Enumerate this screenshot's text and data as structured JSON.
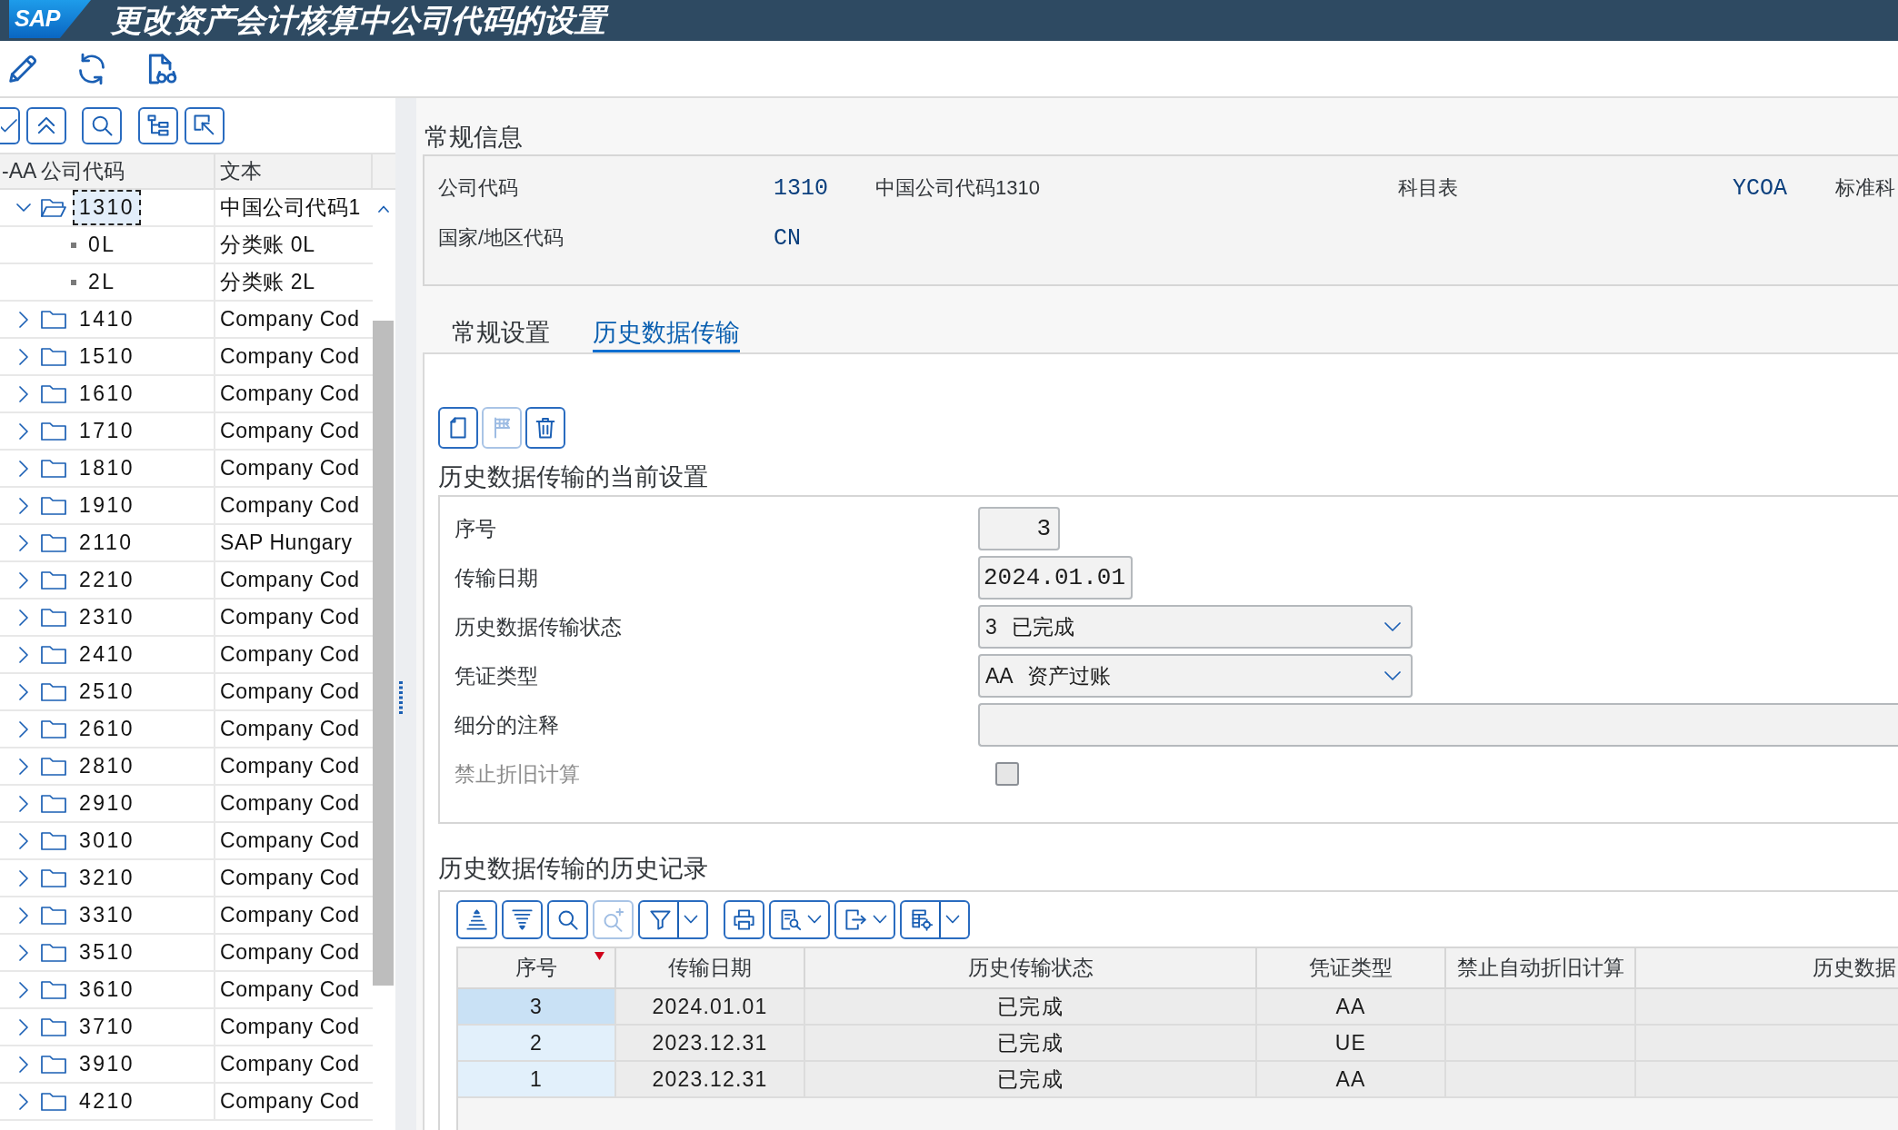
{
  "window": {
    "logo": "SAP",
    "title": "更改资产会计核算中公司代码的设置"
  },
  "toolbar": [
    {
      "kind": "edit"
    },
    {
      "kind": "refresh"
    },
    {
      "kind": "display"
    }
  ],
  "tree_toolbar": [
    {
      "kind": "check"
    },
    {
      "kind": "collapse"
    },
    {
      "kind": "search"
    },
    {
      "kind": "tree"
    },
    {
      "kind": "select"
    }
  ],
  "tree": {
    "columns": [
      "-AA 公司代码",
      "文本"
    ],
    "items": [
      {
        "kind": "folder",
        "code": "1310",
        "text": "中国公司代码1",
        "expanded": true,
        "selected": true,
        "children": [
          {
            "kind": "leaf",
            "code": "0L",
            "text": "分类账 0L",
            "selected": false
          },
          {
            "kind": "leaf",
            "code": "2L",
            "text": "分类账 2L",
            "selected": false
          }
        ]
      },
      {
        "kind": "folder",
        "code": "1410",
        "text": "Company Cod",
        "expanded": false,
        "selected": false
      },
      {
        "kind": "folder",
        "code": "1510",
        "text": "Company Cod",
        "expanded": false,
        "selected": false
      },
      {
        "kind": "folder",
        "code": "1610",
        "text": "Company Cod",
        "expanded": false,
        "selected": false
      },
      {
        "kind": "folder",
        "code": "1710",
        "text": "Company Cod",
        "expanded": false,
        "selected": false
      },
      {
        "kind": "folder",
        "code": "1810",
        "text": "Company Cod",
        "expanded": false,
        "selected": false
      },
      {
        "kind": "folder",
        "code": "1910",
        "text": "Company Cod",
        "expanded": false,
        "selected": false
      },
      {
        "kind": "folder",
        "code": "2110",
        "text": "SAP Hungary",
        "expanded": false,
        "selected": false
      },
      {
        "kind": "folder",
        "code": "2210",
        "text": "Company Cod",
        "expanded": false,
        "selected": false
      },
      {
        "kind": "folder",
        "code": "2310",
        "text": "Company Cod",
        "expanded": false,
        "selected": false
      },
      {
        "kind": "folder",
        "code": "2410",
        "text": "Company Cod",
        "expanded": false,
        "selected": false
      },
      {
        "kind": "folder",
        "code": "2510",
        "text": "Company Cod",
        "expanded": false,
        "selected": false
      },
      {
        "kind": "folder",
        "code": "2610",
        "text": "Company Cod",
        "expanded": false,
        "selected": false
      },
      {
        "kind": "folder",
        "code": "2810",
        "text": "Company Cod",
        "expanded": false,
        "selected": false
      },
      {
        "kind": "folder",
        "code": "2910",
        "text": "Company Cod",
        "expanded": false,
        "selected": false
      },
      {
        "kind": "folder",
        "code": "3010",
        "text": "Company Cod",
        "expanded": false,
        "selected": false
      },
      {
        "kind": "folder",
        "code": "3210",
        "text": "Company Cod",
        "expanded": false,
        "selected": false
      },
      {
        "kind": "folder",
        "code": "3310",
        "text": "Company Cod",
        "expanded": false,
        "selected": false
      },
      {
        "kind": "folder",
        "code": "3510",
        "text": "Company Cod",
        "expanded": false,
        "selected": false
      },
      {
        "kind": "folder",
        "code": "3610",
        "text": "Company Cod",
        "expanded": false,
        "selected": false
      },
      {
        "kind": "folder",
        "code": "3710",
        "text": "Company Cod",
        "expanded": false,
        "selected": false
      },
      {
        "kind": "folder",
        "code": "3910",
        "text": "Company Cod",
        "expanded": false,
        "selected": false
      },
      {
        "kind": "folder",
        "code": "4210",
        "text": "Company Cod",
        "expanded": false,
        "selected": false
      }
    ]
  },
  "general_info": {
    "title": "常规信息",
    "fields": [
      {
        "label": "公司代码",
        "value": "1310",
        "description": "中国公司代码1310"
      },
      {
        "label": "科目表",
        "value": "YCOA",
        "description": "标准科"
      },
      {
        "label": "国家/地区代码",
        "value": "CN"
      }
    ]
  },
  "tabs": [
    {
      "label": "常规设置",
      "selected": false
    },
    {
      "label": "历史数据传输",
      "selected": true
    }
  ],
  "current_settings": {
    "toolbar": [
      {
        "kind": "new",
        "disabled": false
      },
      {
        "kind": "flag",
        "disabled": true
      },
      {
        "kind": "delete",
        "disabled": false
      }
    ],
    "title": "历史数据传输的当前设置",
    "fields": [
      {
        "kind": "number",
        "label": "序号",
        "value": "3"
      },
      {
        "kind": "date",
        "label": "传输日期",
        "value": "2024.01.01"
      },
      {
        "kind": "select",
        "label": "历史数据传输状态",
        "value": "3 已完成"
      },
      {
        "kind": "select",
        "label": "凭证类型",
        "value": "AA 资产过账"
      },
      {
        "kind": "text",
        "label": "细分的注释"
      },
      {
        "kind": "checkbox",
        "label": "禁止折旧计算",
        "checked": false,
        "disabled": true
      }
    ]
  },
  "history": {
    "title": "历史数据传输的历史记录",
    "toolbar": [
      {
        "kind": "sort-asc",
        "disabled": false,
        "dropdown": false,
        "split": false
      },
      {
        "kind": "sort-desc",
        "disabled": false,
        "dropdown": false,
        "split": false
      },
      {
        "kind": "find",
        "disabled": false,
        "dropdown": false,
        "split": false
      },
      {
        "kind": "find-next",
        "disabled": true,
        "dropdown": false,
        "split": false
      },
      {
        "kind": "filter",
        "disabled": false,
        "dropdown": true,
        "split": true
      },
      {
        "kind": "print",
        "disabled": false,
        "dropdown": false,
        "split": false
      },
      {
        "kind": "view",
        "disabled": false,
        "dropdown": true,
        "split": false
      },
      {
        "kind": "export",
        "disabled": false,
        "dropdown": true,
        "split": false
      },
      {
        "kind": "layout",
        "disabled": false,
        "dropdown": true,
        "split": true
      }
    ],
    "columns": [
      {
        "label": "序号",
        "sorted": true
      },
      {
        "label": "传输日期",
        "sorted": false
      },
      {
        "label": "历史传输状态",
        "sorted": false
      },
      {
        "label": "凭证类型",
        "sorted": false
      },
      {
        "label": "禁止自动折旧计算",
        "sorted": false
      },
      {
        "label": "历史数据",
        "sorted": false
      }
    ],
    "rows": [
      {
        "selected": true,
        "cells": [
          "3",
          "2024.01.01",
          "已完成",
          "AA"
        ]
      },
      {
        "selected": false,
        "cells": [
          "2",
          "2023.12.31",
          "已完成",
          "UE"
        ]
      },
      {
        "selected": false,
        "cells": [
          "1",
          "2023.12.31",
          "已完成",
          "AA"
        ]
      }
    ]
  }
}
